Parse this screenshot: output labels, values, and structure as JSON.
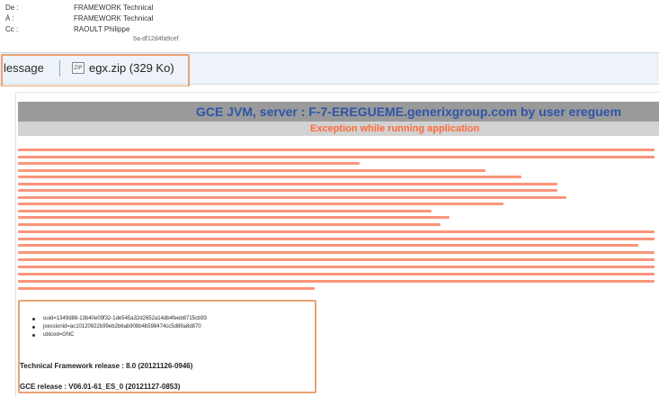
{
  "header": {
    "from_label": "De :",
    "from_value": "FRAMEWORK Technical",
    "to_label": "À :",
    "to_value": "FRAMEWORK Technical",
    "cc_label": "Cc :",
    "cc_value": "RAOULT Philippe",
    "id_tail": "5a-df12d4fa9cef"
  },
  "attachments": {
    "message_tab": "lessage",
    "file_icon_text": "ZIP",
    "file_name": "egx.zip (329 Ko)"
  },
  "error_page": {
    "title": "GCE JVM, server : F-7-EREGUEME.generixgroup.com by user ereguem",
    "subtitle": "Exception while running application",
    "info_items": [
      "uuid=1349d88-13b40e09f32-1de545a32d2652a14db4feeb8715cb93",
      "jsessionid=ac10120922b99eb2b6ab908b4b598474cc5d89a8d870",
      "ubicod=GNC"
    ],
    "framework_release": "Technical Framework release : 8.0 (20121126-0946)",
    "gce_release": "GCE release : V06.01-61_ES_0 (20121127-0853)"
  },
  "colors": {
    "accent_box": "#e8a173",
    "title_blue": "#2e55a8",
    "error_orange": "#ff6a3a",
    "trace_red": "#fb8a6c"
  }
}
